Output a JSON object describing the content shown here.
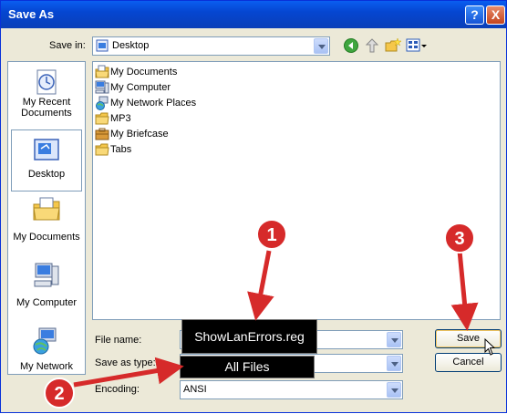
{
  "window": {
    "title": "Save As",
    "help_label": "?",
    "close_label": "X"
  },
  "toolbar": {
    "save_in_label": "Save in:",
    "save_in_value": "Desktop"
  },
  "places": [
    {
      "line1": "My Recent",
      "line2": "Documents"
    },
    {
      "line1": "Desktop",
      "line2": ""
    },
    {
      "line1": "My Documents",
      "line2": ""
    },
    {
      "line1": "My Computer",
      "line2": ""
    },
    {
      "line1": "My Network",
      "line2": ""
    }
  ],
  "files": [
    {
      "name": "My Documents",
      "icon": "my-documents-icon"
    },
    {
      "name": "My Computer",
      "icon": "my-computer-icon"
    },
    {
      "name": "My Network Places",
      "icon": "network-places-icon"
    },
    {
      "name": "MP3",
      "icon": "folder-icon"
    },
    {
      "name": "My Briefcase",
      "icon": "briefcase-icon"
    },
    {
      "name": "Tabs",
      "icon": "folder-icon"
    }
  ],
  "form": {
    "file_name_label": "File name:",
    "file_name_value": "ShowLanErrors.reg",
    "save_as_type_label": "Save as type:",
    "save_as_type_value": "All Files",
    "encoding_label": "Encoding:",
    "encoding_value": "ANSI"
  },
  "buttons": {
    "save": "Save",
    "cancel": "Cancel"
  },
  "annotations": {
    "marker_1": "1",
    "marker_2": "2",
    "marker_3": "3",
    "color": "#d62a2a"
  }
}
